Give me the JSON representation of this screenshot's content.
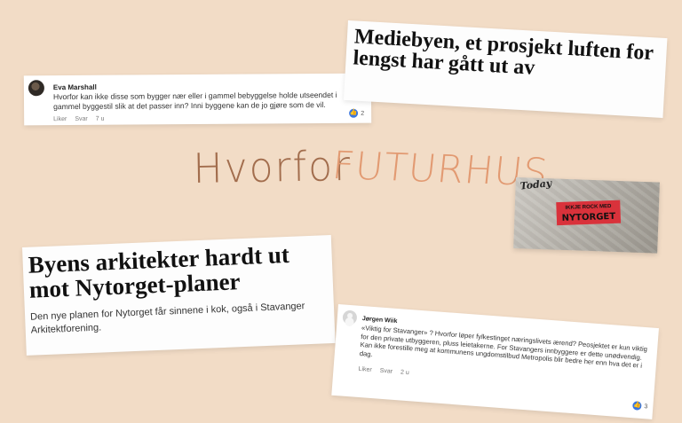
{
  "comment_top": {
    "author": "Eva Marshall",
    "text": "Hvorfor kan ikke disse som bygger nær eller i gammel bebyggelse holde utseendet i gammel byggestil slik at det passer inn? Inni byggene kan de jo gjøre som de vil.",
    "like_label": "Liker",
    "reply_label": "Svar",
    "time": "7 u",
    "reaction_count": "2",
    "reaction_icon": "thumbs-up-icon",
    "reaction_color": "#3b77e0"
  },
  "headline_top": {
    "text": "Mediebyen, et prosjekt luften for lengst har gått ut av"
  },
  "handwriting": {
    "word1": "Hvorfor",
    "word2": "FUTURHUS"
  },
  "photo": {
    "tag": "Today",
    "sticker_line1": "IKKJE ROCK MED",
    "sticker_line2": "NYTORGET",
    "sticker_color": "#d9323b"
  },
  "headline_bottom": {
    "text": "Byens arkitekter hardt ut mot Nytorget-planer",
    "lead": "Den nye planen for Nytorget får sinnene i kok, også i Stavanger Arkitektforening."
  },
  "comment_bottom": {
    "author": "Jørgen Wiik",
    "text": "«Viktig for Stavanger» ? Hvorfor løper fylkestinget næringslivets ærend? Peosjektet er kun viktig for den private utbyggeren, pluss leietakerne. For Stavangers innbyggere er dette unødvendig. Kan ikke forestille meg at kommunens ungdomstilbud Metropolis blir bedre her enn hva det er i dag.",
    "like_label": "Liker",
    "reply_label": "Svar",
    "time": "2 u",
    "reaction_count": "3",
    "reaction_icon": "thumbs-up-icon"
  },
  "colors": {
    "background": "#f2dcc6",
    "handwriting_dark": "#a26d4d",
    "handwriting_light": "#e29a72"
  }
}
